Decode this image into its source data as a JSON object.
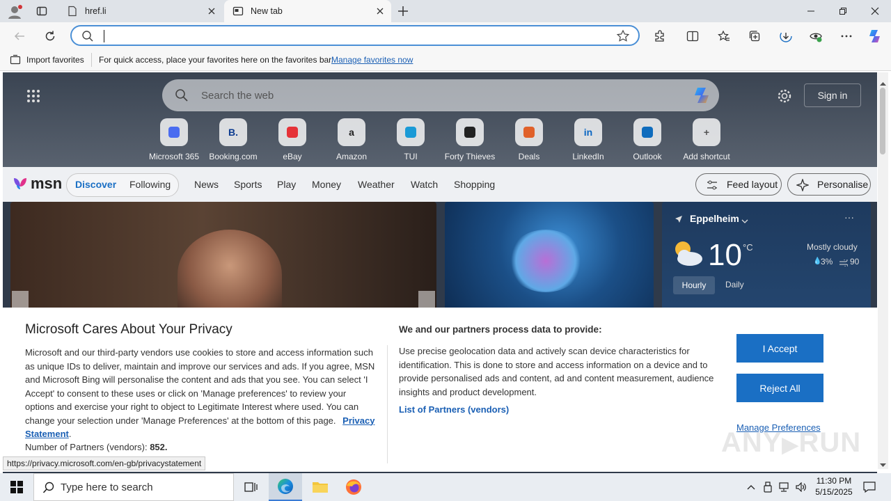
{
  "browser": {
    "tabs": [
      {
        "label": "href.li",
        "active": false
      },
      {
        "label": "New tab",
        "active": true
      }
    ],
    "address": {
      "value": "",
      "placeholder": ""
    },
    "favorites_bar": {
      "import_label": "Import favorites",
      "message": "For quick access, place your favorites here on the favorites bar.",
      "manage_link": "Manage favorites now"
    }
  },
  "newtab": {
    "search_placeholder": "Search the web",
    "sign_in": "Sign in",
    "shortcuts": [
      {
        "label": "Microsoft 365",
        "icon": "m365-icon"
      },
      {
        "label": "Booking.com",
        "icon": "booking-icon",
        "glyph": "B."
      },
      {
        "label": "eBay",
        "icon": "ebay-icon"
      },
      {
        "label": "Amazon",
        "icon": "amazon-icon",
        "glyph": "a"
      },
      {
        "label": "TUI",
        "icon": "tui-icon"
      },
      {
        "label": "Forty Thieves",
        "icon": "forty-thieves-icon"
      },
      {
        "label": "Deals",
        "icon": "deals-icon"
      },
      {
        "label": "LinkedIn",
        "icon": "linkedin-icon",
        "glyph": "in"
      },
      {
        "label": "Outlook",
        "icon": "outlook-icon"
      },
      {
        "label": "Add shortcut",
        "icon": "plus-icon",
        "glyph": "+"
      }
    ],
    "msn": {
      "logo": "msn",
      "tabs": [
        "Discover",
        "Following"
      ],
      "nav": [
        "News",
        "Sports",
        "Play",
        "Money",
        "Weather",
        "Watch",
        "Shopping"
      ],
      "feed_layout": "Feed layout",
      "personalise": "Personalise"
    },
    "weather": {
      "location": "Eppelheim",
      "temp": "10",
      "unit": "°C",
      "condition": "Mostly cloudy",
      "precip": "3%",
      "wind": "90",
      "tabs": [
        "Hourly",
        "Daily"
      ]
    }
  },
  "privacy": {
    "title": "Microsoft Cares About Your Privacy",
    "body": "Microsoft and our third-party vendors use cookies to store and access information such as unique IDs to deliver, maintain and improve our services and ads. If you agree, MSN and Microsoft Bing will personalise the content and ads that you see. You can select 'I Accept' to consent to these uses or click on 'Manage preferences' to review your options and exercise your right to object to Legitimate Interest where used.  You can change your selection under 'Manage Preferences' at the bottom of this page.",
    "privacy_link": "Privacy Statement",
    "partners_label": "Number of Partners (vendors):",
    "partners_count": "852.",
    "right_title": "We and our partners process data to provide:",
    "right_body": "Use precise geolocation data and actively scan device characteristics for identification. This is done to store and access information on a device and to provide personalised ads and content, ad and content measurement, audience insights and product development.",
    "partners_link": "List of Partners (vendors)",
    "accept": "I Accept",
    "reject": "Reject All",
    "manage": "Manage Preferences"
  },
  "status_url": "https://privacy.microsoft.com/en-gb/privacystatement",
  "taskbar": {
    "search_placeholder": "Type here to search",
    "time": "11:30 PM",
    "date": "5/15/2025"
  },
  "colors": {
    "accent": "#1a6fc4",
    "address_border": "#4a8fd6"
  }
}
